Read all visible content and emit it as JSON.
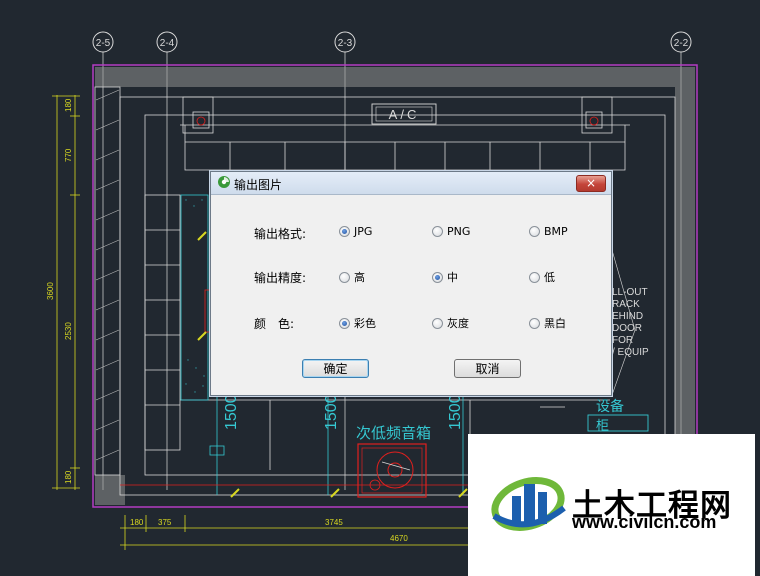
{
  "drawing": {
    "grid_bubbles": [
      "2-5",
      "2-4",
      "2-3",
      "2-2"
    ],
    "ac_label": "A/C",
    "left_dims": [
      "180",
      "770",
      "3600",
      "2530",
      "180"
    ],
    "bottom_dims": [
      "180",
      "375",
      "3745",
      "4670"
    ],
    "rotated_dims": [
      "1500",
      "1500",
      "1500"
    ],
    "subwoofer_label": "次低频音箱",
    "equipment_label": "设备",
    "equipment_sub": "柜",
    "right_note_lines": [
      "LL-OUT",
      "RACK",
      "EHIND",
      "DOOR",
      "FOR",
      "/ EQUIP"
    ]
  },
  "dialog": {
    "title": "输出图片",
    "close_symbol": "×",
    "rows": [
      {
        "label": "输出格式:",
        "options": [
          "JPG",
          "PNG",
          "BMP"
        ],
        "selected": 0
      },
      {
        "label": "输出精度:",
        "options": [
          "高",
          "中",
          "低"
        ],
        "selected": 1
      },
      {
        "label": "颜　色:",
        "options": [
          "彩色",
          "灰度",
          "黑白"
        ],
        "selected": 0
      }
    ],
    "ok_label": "确定",
    "cancel_label": "取消"
  },
  "watermark": {
    "title": "土木工程网",
    "url": "www.civilcn.com"
  },
  "colors": {
    "background": "#212830",
    "cad_white": "#d9d9d9",
    "cad_magenta": "#b43cc3",
    "cad_cyan": "#35c8d2",
    "cad_red": "#e0201e",
    "cad_yellow": "#d8d820",
    "logo_blue": "#1c5fae",
    "logo_green": "#6fb83a"
  }
}
